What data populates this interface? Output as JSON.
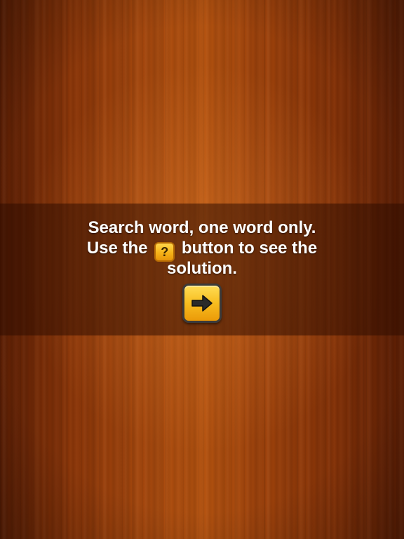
{
  "message": {
    "line1": "Search word, one word only.",
    "line2_before": "Use the",
    "line2_after": "button to see the",
    "line3": "solution."
  },
  "help_button": {
    "symbol": "?",
    "icon": "question-icon"
  },
  "next_button": {
    "icon": "arrow-right-icon"
  },
  "colors": {
    "wood": "#a4470d",
    "banner": "#2d0c00",
    "button_yellow": "#f7bd1f",
    "button_border": "#3b3b3b"
  }
}
